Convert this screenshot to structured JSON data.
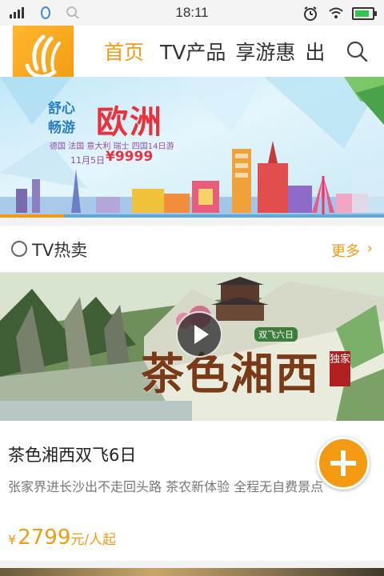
{
  "status_bar": {
    "time": "18:11",
    "icons": [
      "signal-icon",
      "sim-icon",
      "search-icon",
      "alarm-icon",
      "wifi-icon",
      "battery-icon"
    ],
    "battery_level": 0.85
  },
  "header": {
    "logo_icon": "feather-logo-icon",
    "nav": [
      "首页",
      "TV产品",
      "享游惠",
      "出"
    ],
    "active_nav": "首页",
    "search_icon": "search-icon"
  },
  "banner": {
    "small_title_line1": "舒心",
    "small_title_line2": "畅游",
    "big_title": "欧洲",
    "countries": "德国 法国 意大利 瑞士 四国14日游",
    "date": "11月5日",
    "price": "¥9999",
    "current_slide": 1,
    "slide_count": 6
  },
  "section": {
    "icon": "tv-icon",
    "title": "TV热卖",
    "more_label": "更多",
    "more_icon": "chevron-right-icon"
  },
  "product": {
    "art_title": "茶色湘西",
    "art_tag": "双飞六日",
    "art_seal": "独家",
    "play_icon": "play-icon",
    "name": "茶色湘西双飞6日",
    "description": "张家界进长沙出不走回头路 茶农新体验 全程无自费景点",
    "price_symbol": "¥",
    "price": "2799",
    "price_unit": "元/人起"
  },
  "fab": {
    "icon": "plus-icon"
  },
  "colors": {
    "accent": "#f39a12",
    "brand_red": "#e8323c",
    "text_gray": "#777777"
  }
}
